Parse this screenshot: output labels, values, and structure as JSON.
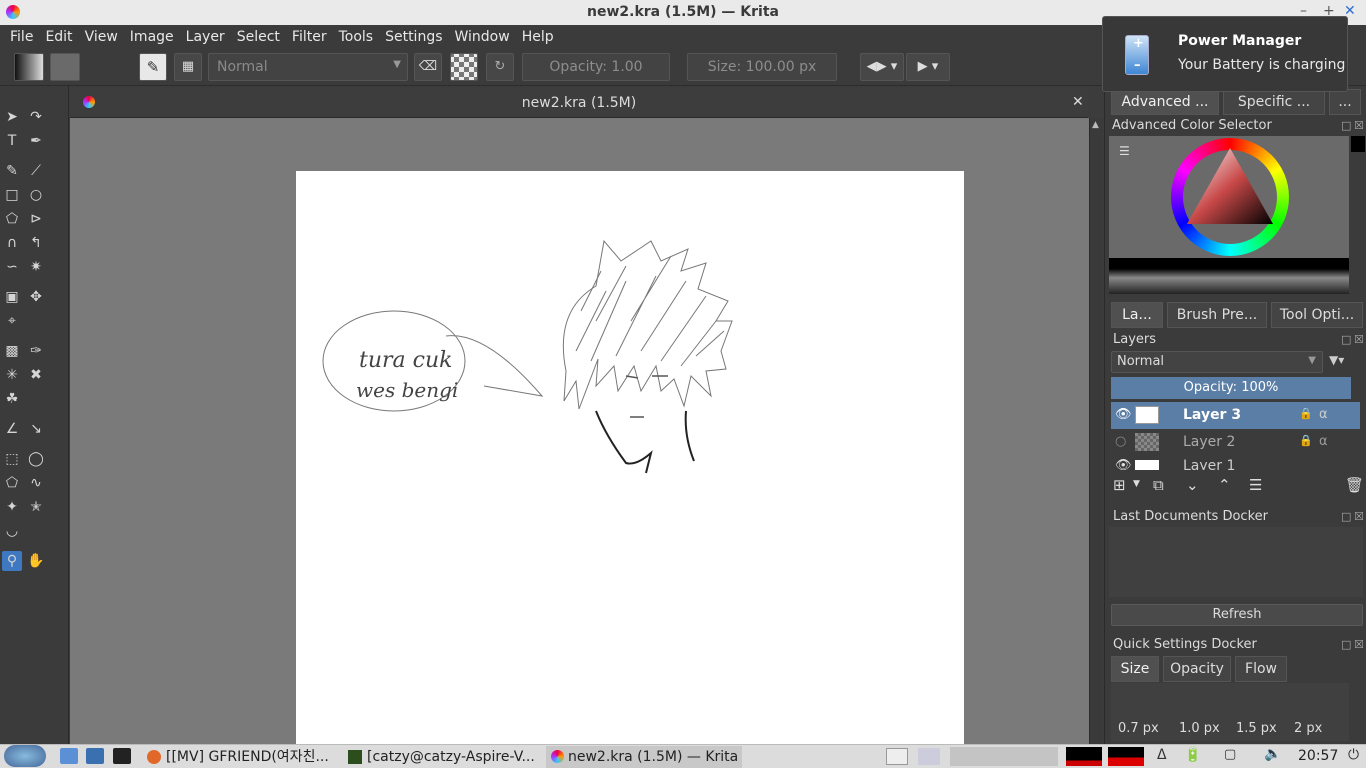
{
  "window": {
    "title": "new2.kra (1.5M)  — Krita"
  },
  "menu": [
    "File",
    "Edit",
    "View",
    "Image",
    "Layer",
    "Select",
    "Filter",
    "Tools",
    "Settings",
    "Window",
    "Help"
  ],
  "toolbar": {
    "blend_mode": "Normal",
    "opacity_label": "Opacity:",
    "opacity_value": "1.00",
    "size_label": "Size:",
    "size_value": "100.00 px"
  },
  "document": {
    "tab_title": "new2.kra (1.5M)"
  },
  "notification": {
    "title": "Power Manager",
    "body": "Your Battery is charging"
  },
  "right_panel": {
    "top_tabs": [
      "Advanced ...",
      "Specific ...",
      "..."
    ],
    "color_selector_title": "Advanced Color Selector",
    "mid_tabs": [
      "La...",
      "Brush Pre...",
      "Tool Opti..."
    ],
    "layers_title": "Layers",
    "layers_blend": "Normal",
    "layers_opacity": "Opacity:  100%",
    "layers": [
      {
        "name": "Layer 3",
        "selected": true
      },
      {
        "name": "Layer 2",
        "selected": false
      },
      {
        "name": "Layer 1",
        "selected": false
      }
    ],
    "last_docs_title": "Last Documents Docker",
    "refresh_label": "Refresh",
    "quick_settings_title": "Quick Settings Docker",
    "quick_tabs": [
      "Size",
      "Opacity",
      "Flow"
    ],
    "sizes": [
      "0.7 px",
      "1.0 px",
      "1.5 px",
      "2 px"
    ]
  },
  "taskbar": {
    "tasks": [
      "[[MV] GFRIEND(여자친...",
      "[catzy@catzy-Aspire-V...",
      "new2.kra (1.5M)  — Krita"
    ],
    "clock": "20:57"
  },
  "drawing": {
    "speech_line1": "tura cuk",
    "speech_line2": "wes bengi"
  }
}
